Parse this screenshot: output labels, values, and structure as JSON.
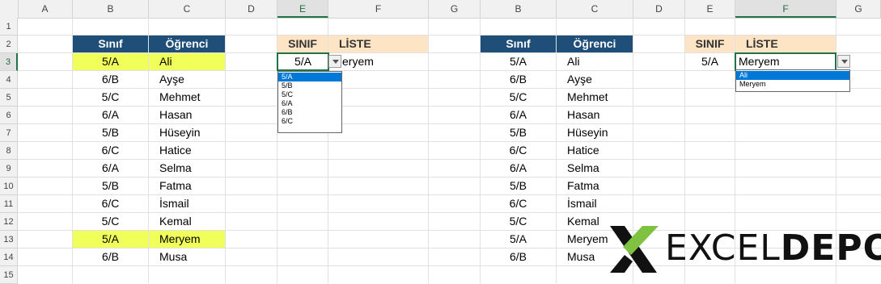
{
  "columns": [
    "A",
    "B",
    "C",
    "D",
    "E",
    "F",
    "G",
    "B",
    "C",
    "D",
    "E",
    "F",
    "G"
  ],
  "rows": [
    "1",
    "2",
    "3",
    "4",
    "5",
    "6",
    "7",
    "8",
    "9",
    "10",
    "11",
    "12",
    "13",
    "14",
    "15"
  ],
  "left_table": {
    "header": {
      "sinif": "Sınıf",
      "ogrenci": "Öğrenci"
    },
    "rows": [
      {
        "sinif": "5/A",
        "ogrenci": "Ali"
      },
      {
        "sinif": "6/B",
        "ogrenci": "Ayşe"
      },
      {
        "sinif": "5/C",
        "ogrenci": "Mehmet"
      },
      {
        "sinif": "6/A",
        "ogrenci": "Hasan"
      },
      {
        "sinif": "5/B",
        "ogrenci": "Hüseyin"
      },
      {
        "sinif": "6/C",
        "ogrenci": "Hatice"
      },
      {
        "sinif": "6/A",
        "ogrenci": "Selma"
      },
      {
        "sinif": "5/B",
        "ogrenci": "Fatma"
      },
      {
        "sinif": "6/C",
        "ogrenci": "İsmail"
      },
      {
        "sinif": "5/C",
        "ogrenci": "Kemal"
      },
      {
        "sinif": "5/A",
        "ogrenci": "Meryem"
      },
      {
        "sinif": "6/B",
        "ogrenci": "Musa"
      }
    ]
  },
  "left_lookup": {
    "header_sinif": "SINIF",
    "header_liste": "LİSTE",
    "sinif_value": "5/A",
    "liste_value": "eryem",
    "dropdown_options": [
      "5/A",
      "5/B",
      "5/C",
      "6/A",
      "6/B",
      "6/C"
    ]
  },
  "right_lookup": {
    "header_sinif": "SINIF",
    "header_liste": "LİSTE",
    "sinif_value": "5/A",
    "liste_value": "Meryem",
    "dropdown_options": [
      "Ali",
      "Meryem"
    ]
  },
  "logo": {
    "part1": "EXCEL",
    "part2": "DEPO"
  },
  "colors": {
    "header_blue": "#1f4e79",
    "header_peach": "#fce4c4",
    "highlight_yellow": "#f0ff5a",
    "selection": "#0078d7",
    "excel_green": "#217346"
  }
}
